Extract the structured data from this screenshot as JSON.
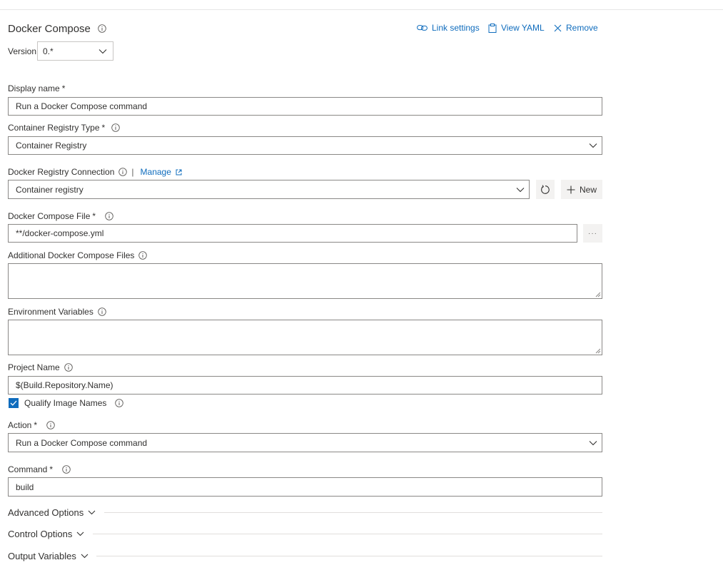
{
  "task": {
    "title": "Docker Compose",
    "version_label": "Version",
    "version_value": "0.*"
  },
  "actions": {
    "link_settings": "Link settings",
    "view_yaml": "View YAML",
    "remove": "Remove"
  },
  "fields": {
    "display_name": {
      "label": "Display name",
      "required": "*",
      "value": "Run a Docker Compose command"
    },
    "registry_type": {
      "label": "Container Registry Type",
      "required": "*",
      "value": "Container Registry"
    },
    "registry_connection": {
      "label": "Docker Registry Connection",
      "separator": "|",
      "manage": "Manage",
      "value": "Container registry",
      "new_button": "New"
    },
    "compose_file": {
      "label": "Docker Compose File",
      "required": "*",
      "value": "**/docker-compose.yml",
      "browse": "···"
    },
    "additional_files": {
      "label": "Additional Docker Compose Files",
      "value": ""
    },
    "env_vars": {
      "label": "Environment Variables",
      "value": ""
    },
    "project_name": {
      "label": "Project Name",
      "value": "$(Build.Repository.Name)"
    },
    "qualify_image_names": {
      "label": "Qualify Image Names",
      "checked": true
    },
    "action": {
      "label": "Action",
      "required": "*",
      "value": "Run a Docker Compose command"
    },
    "command": {
      "label": "Command",
      "required": "*",
      "value": "build"
    }
  },
  "sections": {
    "advanced": "Advanced Options",
    "control": "Control Options",
    "output": "Output Variables"
  },
  "colors": {
    "accent": "#0f6cbd",
    "border": "#8a8886",
    "text": "#323130"
  }
}
